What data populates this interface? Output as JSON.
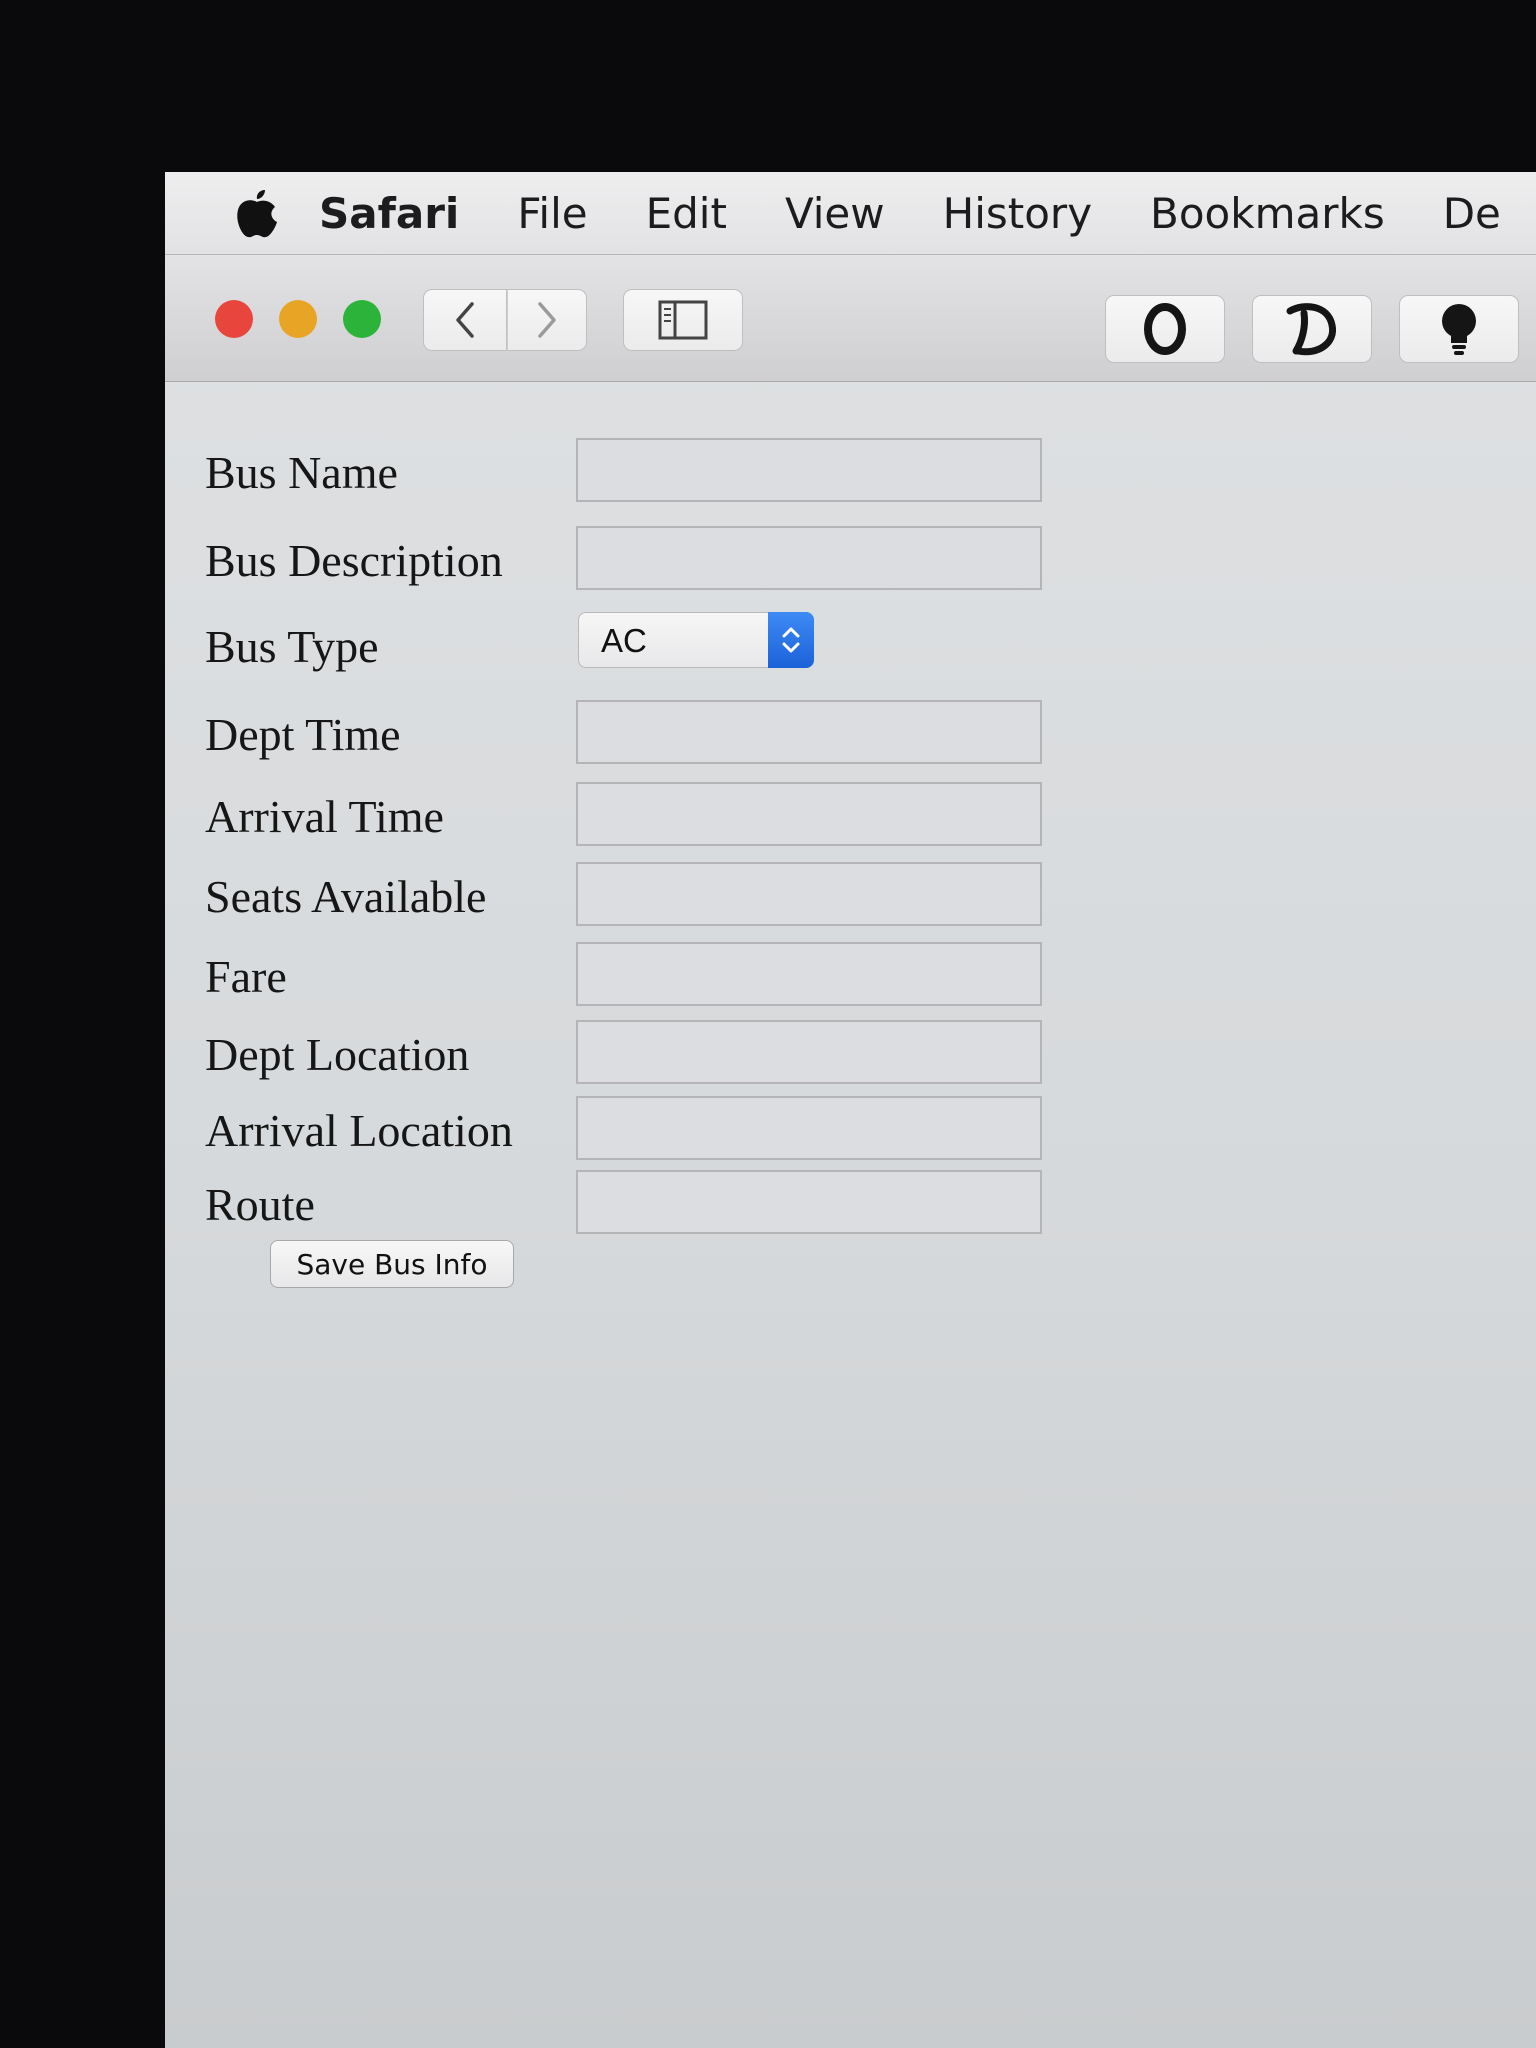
{
  "menubar": {
    "app_name": "Safari",
    "items": [
      "File",
      "Edit",
      "View",
      "History",
      "Bookmarks",
      "De"
    ]
  },
  "toolbar": {
    "icons": [
      "back-arrow",
      "forward-arrow",
      "sidebar",
      "extension-o",
      "extension-d",
      "extension-bulb"
    ]
  },
  "form": {
    "fields": [
      {
        "label": "Bus Name",
        "value": ""
      },
      {
        "label": "Bus Description",
        "value": ""
      },
      {
        "label": "Bus Type",
        "value": "AC"
      },
      {
        "label": "Dept Time",
        "value": ""
      },
      {
        "label": "Arrival Time",
        "value": ""
      },
      {
        "label": "Seats Available",
        "value": ""
      },
      {
        "label": "Fare",
        "value": ""
      },
      {
        "label": "Dept Location",
        "value": ""
      },
      {
        "label": "Arrival Location",
        "value": ""
      },
      {
        "label": "Route",
        "value": ""
      }
    ],
    "save_label": "Save Bus Info"
  },
  "colors": {
    "close": "#e8453c",
    "minimize": "#e8a425",
    "maximize": "#2bb33a",
    "select_accent": "#2a73e8"
  }
}
